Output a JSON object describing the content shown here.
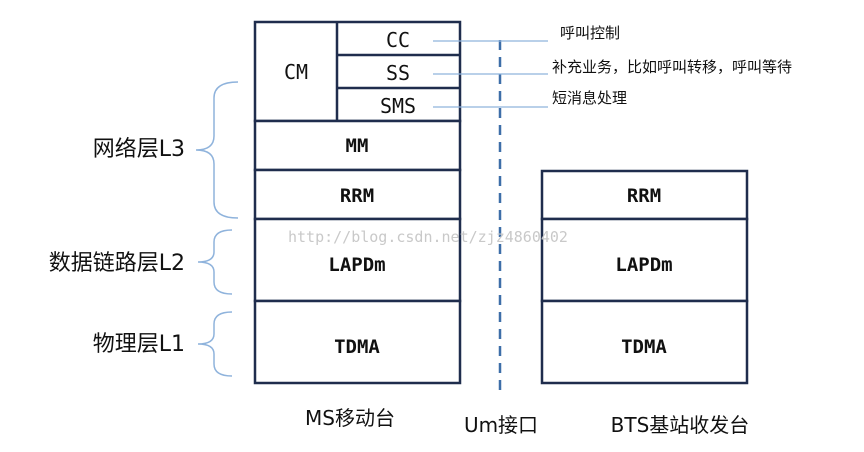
{
  "ms_stack": {
    "cm": "CM",
    "cc": "CC",
    "ss": "SS",
    "sms": "SMS",
    "mm": "MM",
    "rrm": "RRM",
    "lapdm": "LAPDm",
    "tdma": "TDMA"
  },
  "bts_stack": {
    "rrm": "RRM",
    "lapdm": "LAPDm",
    "tdma": "TDMA"
  },
  "layers": {
    "l3": "网络层L3",
    "l2": "数据链路层L2",
    "l1": "物理层L1"
  },
  "annotations": {
    "cc": "呼叫控制",
    "ss": "补充业务，比如呼叫转移，呼叫等待",
    "sms": "短消息处理"
  },
  "captions": {
    "ms": "MS移动台",
    "um": "Um接口",
    "bts": "BTS基站收发台"
  },
  "watermark": "http://blog.csdn.net/zjz4860402"
}
